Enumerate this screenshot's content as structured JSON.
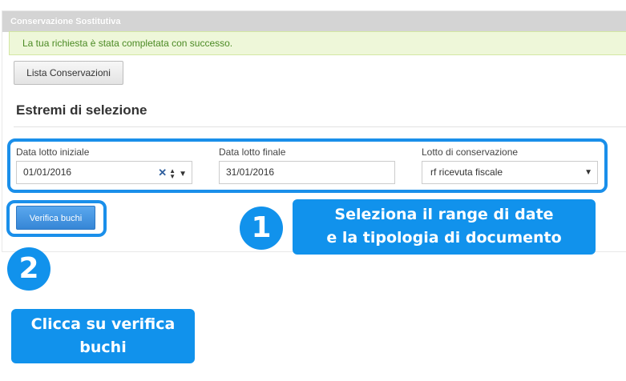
{
  "panel": {
    "title": "Conservazione Sostitutiva"
  },
  "alert": {
    "message": "La tua richiesta è stata completata con successo."
  },
  "buttons": {
    "list_label": "Lista Conservazioni",
    "verify_label": "Verifica buchi"
  },
  "section": {
    "title": "Estremi di selezione"
  },
  "filters": {
    "start_date": {
      "label": "Data lotto iniziale",
      "value": "01/01/2016"
    },
    "end_date": {
      "label": "Data lotto finale",
      "value": "31/01/2016"
    },
    "lot_type": {
      "label": "Lotto di conservazione",
      "value": "rf ricevuta fiscale"
    }
  },
  "annotations": {
    "step1": {
      "number": "1",
      "line1": "Seleziona il range di date",
      "line2": "e la tipologia di documento"
    },
    "step2": {
      "number": "2",
      "line1": "Clicca su verifica",
      "line2": "buchi"
    }
  },
  "colors": {
    "accent": "#1192ec",
    "highlight_border": "#1a8fea",
    "success_text": "#4b8a24",
    "button_primary": "#3686d6"
  },
  "icons": {
    "clear": "close-icon",
    "spinner": "spinner-arrows-icon",
    "dropdown": "chevron-down-icon"
  }
}
